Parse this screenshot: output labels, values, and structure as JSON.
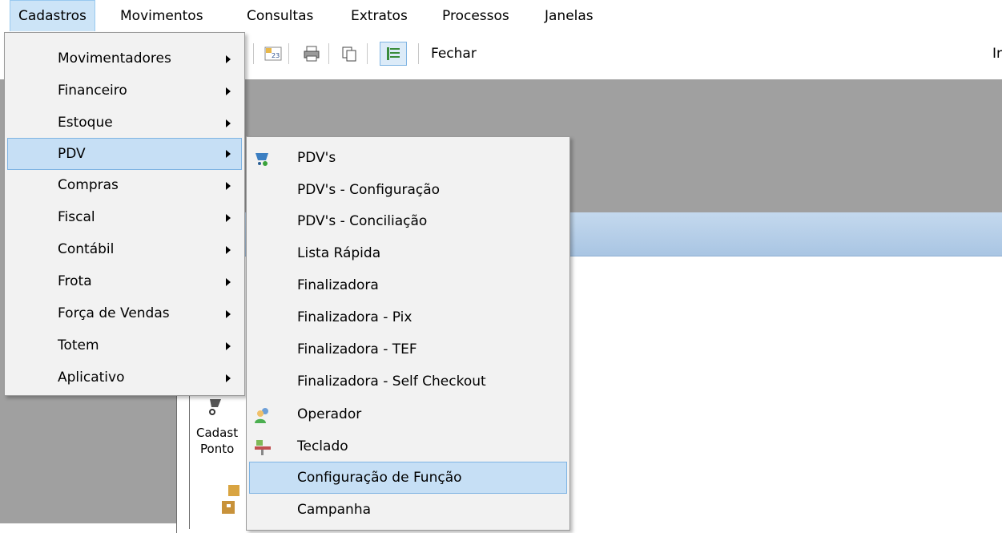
{
  "menubar": {
    "items": [
      "Cadastros",
      "Movimentos",
      "Consultas",
      "Extratos",
      "Processos",
      "Janelas"
    ]
  },
  "toolbar": {
    "close_label": "Fechar",
    "right_cut_text": "Ir"
  },
  "workspace": {
    "icon_label_line1": "Cadast",
    "icon_label_line2": "Ponto"
  },
  "cadastros_menu": {
    "items": [
      {
        "label": "Movimentadores"
      },
      {
        "label": "Financeiro"
      },
      {
        "label": "Estoque"
      },
      {
        "label": "PDV"
      },
      {
        "label": "Compras"
      },
      {
        "label": "Fiscal"
      },
      {
        "label": "Contábil"
      },
      {
        "label": "Frota"
      },
      {
        "label": "Força de Vendas"
      },
      {
        "label": "Totem"
      },
      {
        "label": "Aplicativo"
      }
    ],
    "highlighted": "PDV"
  },
  "pdv_menu": {
    "items": [
      {
        "label": "PDV's",
        "icon": "cart-icon"
      },
      {
        "label": "PDV's - Configuração",
        "icon": ""
      },
      {
        "label": "PDV's - Conciliação",
        "icon": ""
      },
      {
        "label": "Lista Rápida",
        "icon": ""
      },
      {
        "label": "Finalizadora",
        "icon": ""
      },
      {
        "label": "Finalizadora - Pix",
        "icon": ""
      },
      {
        "label": "Finalizadora - TEF",
        "icon": ""
      },
      {
        "label": "Finalizadora - Self Checkout",
        "icon": ""
      },
      {
        "label": "Operador",
        "icon": "users-icon"
      },
      {
        "label": "Teclado",
        "icon": "keyboard-icon"
      },
      {
        "label": "Configuração de Função",
        "icon": ""
      },
      {
        "label": "Campanha",
        "icon": ""
      }
    ],
    "highlighted": "Configuração de Função"
  },
  "colors": {
    "highlight": "#c6dff5",
    "highlight_border": "#7fb4e3",
    "menu_bg": "#f2f2f2",
    "workspace": "#a0a0a0"
  }
}
